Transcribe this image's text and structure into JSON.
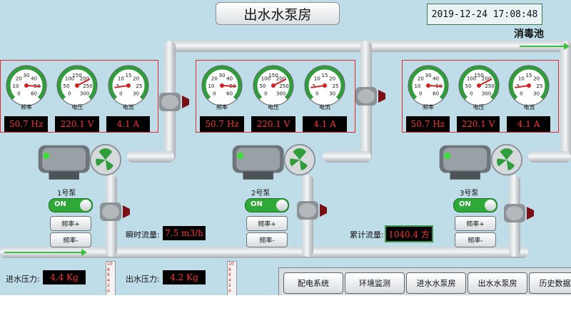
{
  "header": {
    "title": "出水水泵房",
    "datetime": "2019-12-24 17:08:48"
  },
  "pool_label": "消毒池",
  "colors": {
    "background": "#bfdde8",
    "pipe": "#e8ebed",
    "readout_text": "#ff3030",
    "on_green": "#2ea836",
    "panel_border": "#e0282d"
  },
  "pumps": [
    {
      "name": "1号泵",
      "toggle": "ON",
      "freq_up": "频率+",
      "freq_down": "频率-",
      "gauges": [
        {
          "caption": "频率",
          "ticks": [
            "0",
            "10",
            "20",
            "30",
            "40",
            "50",
            "60"
          ],
          "value": 50.7,
          "min": 0,
          "max": 60,
          "readout": "50.7 Hz"
        },
        {
          "caption": "电压",
          "ticks": [
            "0",
            "50",
            "100",
            "150",
            "200",
            "250",
            "300"
          ],
          "value": 220.1,
          "min": 0,
          "max": 300,
          "readout": "220.1 V"
        },
        {
          "caption": "电流",
          "ticks": [
            "0",
            "5",
            "10",
            "15",
            "20",
            "25",
            "30"
          ],
          "value": 4.1,
          "min": 0,
          "max": 30,
          "readout": "4.1 A"
        }
      ]
    },
    {
      "name": "2号泵",
      "toggle": "ON",
      "freq_up": "频率+",
      "freq_down": "频率-",
      "gauges": [
        {
          "caption": "频率",
          "ticks": [
            "0",
            "10",
            "20",
            "30",
            "40",
            "50",
            "60"
          ],
          "value": 50.7,
          "min": 0,
          "max": 60,
          "readout": "50.7 Hz"
        },
        {
          "caption": "电压",
          "ticks": [
            "0",
            "50",
            "100",
            "150",
            "200",
            "250",
            "300"
          ],
          "value": 220.1,
          "min": 0,
          "max": 300,
          "readout": "220.1 V"
        },
        {
          "caption": "电流",
          "ticks": [
            "0",
            "5",
            "10",
            "15",
            "20",
            "25",
            "30"
          ],
          "value": 4.1,
          "min": 0,
          "max": 30,
          "readout": "4.1 A"
        }
      ]
    },
    {
      "name": "3号泵",
      "toggle": "ON",
      "freq_up": "频率+",
      "freq_down": "频率-",
      "gauges": [
        {
          "caption": "频率",
          "ticks": [
            "0",
            "10",
            "20",
            "30",
            "40",
            "50",
            "60"
          ],
          "value": 50.7,
          "min": 0,
          "max": 60,
          "readout": "50.7 Hz"
        },
        {
          "caption": "电压",
          "ticks": [
            "0",
            "50",
            "100",
            "150",
            "200",
            "250",
            "300"
          ],
          "value": 220.1,
          "min": 0,
          "max": 300,
          "readout": "220.1 V"
        },
        {
          "caption": "电流",
          "ticks": [
            "0",
            "5",
            "10",
            "15",
            "20",
            "25",
            "30"
          ],
          "value": 4.1,
          "min": 0,
          "max": 30,
          "readout": "4.1 A"
        }
      ]
    }
  ],
  "flow": {
    "instant_label": "瞬时流量:",
    "instant_value": "7.5 m3/h",
    "total_label": "累计流量:",
    "total_value": "1040.4 方"
  },
  "pressure": {
    "inlet_label": "进水压力:",
    "inlet_value": "4.4 Kg",
    "outlet_label": "出水压力:",
    "outlet_value": "4.2 Kg",
    "scale": [
      "10",
      "8",
      "6",
      "4",
      "2",
      "0"
    ]
  },
  "nav": [
    "配电系统",
    "环境监测",
    "进水水泵房",
    "出水水泵房",
    "历史数据表"
  ]
}
